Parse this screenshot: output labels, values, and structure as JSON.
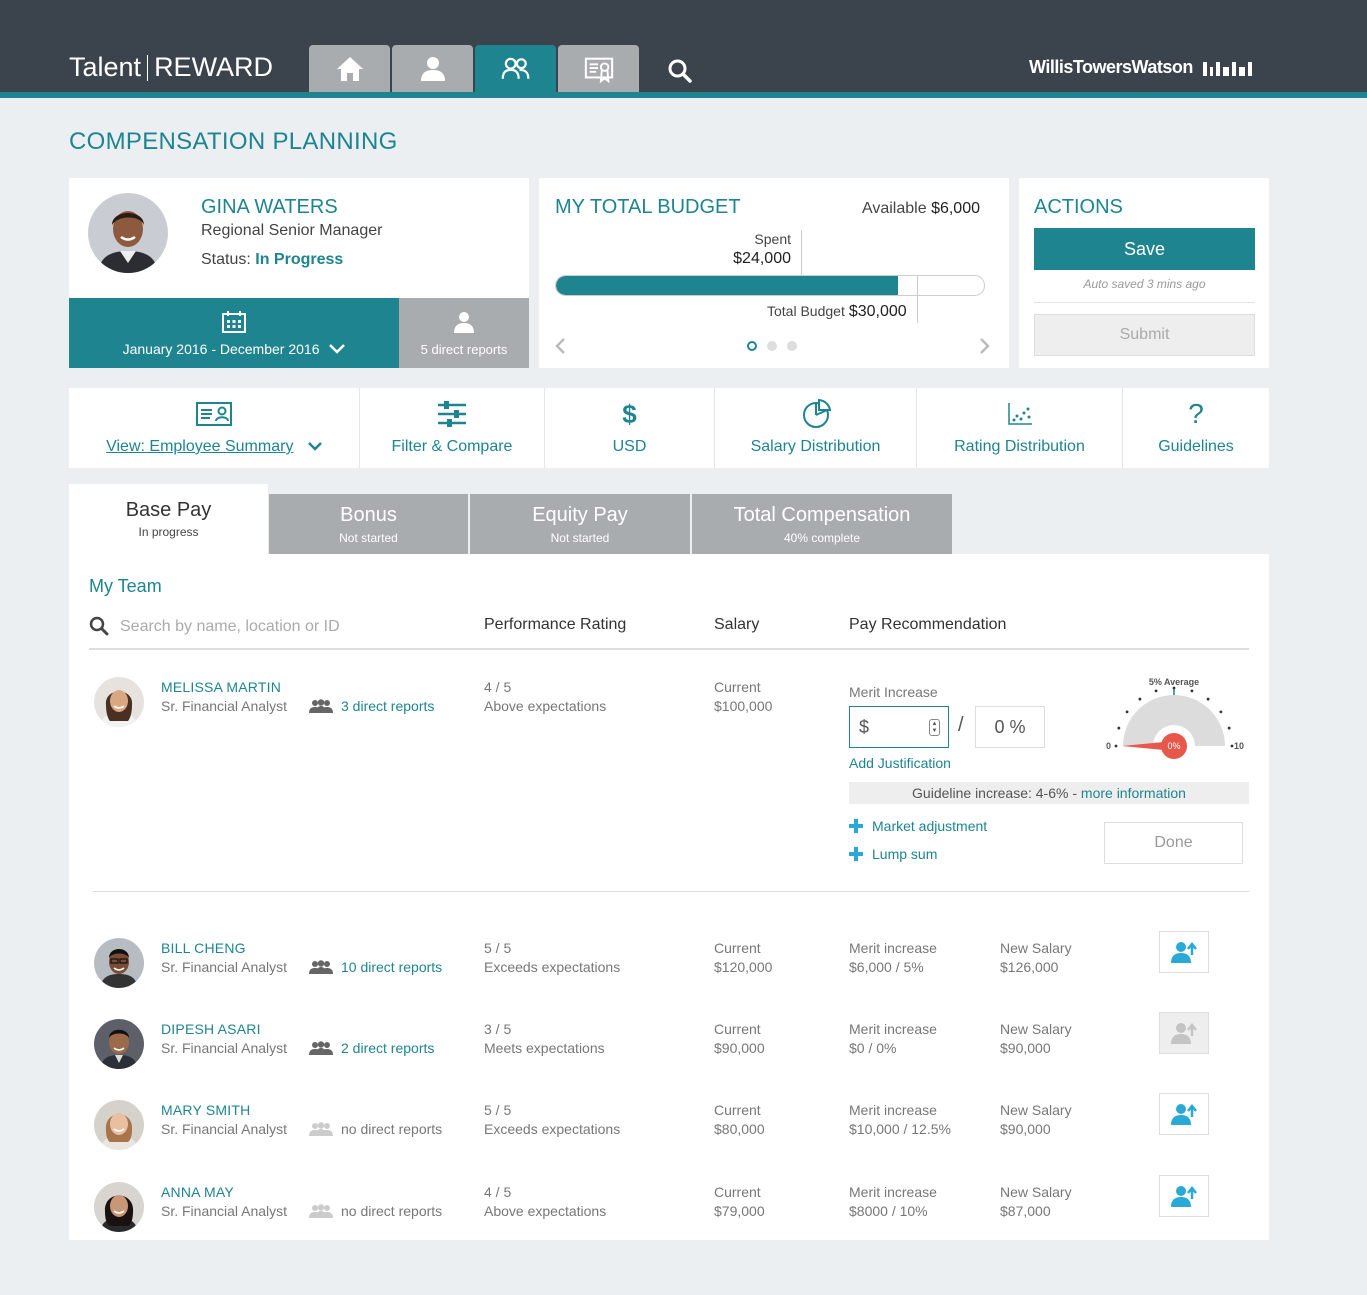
{
  "app": {
    "brand_left": "Talent",
    "brand_right": "REWARD",
    "company": "WillisTowersWatson"
  },
  "nav": {
    "tabs": [
      {
        "name": "home",
        "icon": "home-icon",
        "active": false
      },
      {
        "name": "profile",
        "icon": "person-icon",
        "active": false
      },
      {
        "name": "team",
        "icon": "team-icon",
        "active": true
      },
      {
        "name": "certificate",
        "icon": "certificate-icon",
        "active": false
      }
    ],
    "search_icon": "search-icon"
  },
  "page": {
    "title": "COMPENSATION PLANNING"
  },
  "employee": {
    "name": "GINA WATERS",
    "role": "Regional Senior Manager",
    "status_label": "Status:",
    "status_value": "In Progress",
    "period": "January 2016 - December 2016",
    "reports": "5 direct reports"
  },
  "budget": {
    "title": "MY TOTAL BUDGET",
    "available_label": "Available",
    "available_value": "$6,000",
    "spent_label": "Spent",
    "spent_value": "$24,000",
    "total_label": "Total Budget",
    "total_value": "$30,000",
    "spent_fraction": 0.8,
    "carousel_pages": 3,
    "carousel_active": 0
  },
  "actions": {
    "title": "ACTIONS",
    "save": "Save",
    "autosave": "Auto saved 3 mins ago",
    "submit": "Submit"
  },
  "tools": [
    {
      "icon": "employee-card-icon",
      "label": "View: Employee Summary",
      "dropdown": true
    },
    {
      "icon": "sliders-icon",
      "label": "Filter & Compare"
    },
    {
      "icon": "dollar-icon",
      "label": "USD"
    },
    {
      "icon": "pie-chart-icon",
      "label": "Salary Distribution"
    },
    {
      "icon": "scatter-chart-icon",
      "label": "Rating Distribution"
    },
    {
      "icon": "question-icon",
      "label": "Guidelines"
    }
  ],
  "pay_tabs": [
    {
      "name": "Base Pay",
      "sub": "In progress",
      "active": true
    },
    {
      "name": "Bonus",
      "sub": "Not started"
    },
    {
      "name": "Equity Pay",
      "sub": "Not started"
    },
    {
      "name": "Total Compensation",
      "sub": "40% complete"
    }
  ],
  "team": {
    "title": "My Team",
    "search_placeholder": "Search by name, location or ID",
    "columns": [
      "Performance Rating",
      "Salary",
      "Pay Recommendation"
    ],
    "expanded": {
      "name": "MELISSA MARTIN",
      "title": "Sr. Financial Analyst",
      "reports": "3 direct reports",
      "rating": "4 / 5",
      "rating_text": "Above expectations",
      "salary_label": "Current",
      "salary": "$100,000",
      "merit_label": "Merit Increase",
      "currency_symbol": "$",
      "percent_value": "0 %",
      "add_justification": "Add Justification",
      "guideline_text": "Guideline increase: 4-6%",
      "guideline_sep": " - ",
      "guideline_link": "more information",
      "market_adjustment": "Market adjustment",
      "lump_sum": "Lump sum",
      "done": "Done",
      "gauge": {
        "title": "5% Average",
        "min": "0",
        "max": "10",
        "value_label": "0%",
        "value": 0,
        "average": 5
      }
    },
    "rows": [
      {
        "name": "BILL CHENG",
        "title": "Sr. Financial Analyst",
        "reports": "10 direct reports",
        "has_reports": true,
        "rating": "5 / 5",
        "rating_text": "Exceeds expectations",
        "salary_label": "Current",
        "salary": "$120,000",
        "merit_label": "Merit increase",
        "merit": "$6,000 / 5%",
        "new_label": "New Salary",
        "new_salary": "$126,000",
        "promote_enabled": true
      },
      {
        "name": "DIPESH ASARI",
        "title": "Sr. Financial Analyst",
        "reports": "2 direct reports",
        "has_reports": true,
        "rating": "3 / 5",
        "rating_text": "Meets expectations",
        "salary_label": "Current",
        "salary": "$90,000",
        "merit_label": "Merit increase",
        "merit": "$0 / 0%",
        "new_label": "New Salary",
        "new_salary": "$90,000",
        "promote_enabled": false
      },
      {
        "name": "MARY SMITH",
        "title": "Sr. Financial Analyst",
        "reports": "no direct reports",
        "has_reports": false,
        "rating": "5 / 5",
        "rating_text": "Exceeds expectations",
        "salary_label": "Current",
        "salary": "$80,000",
        "merit_label": "Merit increase",
        "merit": "$10,000 / 12.5%",
        "new_label": "New Salary",
        "new_salary": "$90,000",
        "promote_enabled": true
      },
      {
        "name": "ANNA MAY",
        "title": "Sr. Financial Analyst",
        "reports": "no direct reports",
        "has_reports": false,
        "rating": "4 / 5",
        "rating_text": "Above expectations",
        "salary_label": "Current",
        "salary": "$79,000",
        "merit_label": "Merit increase",
        "merit": "$8000 / 10%",
        "new_label": "New Salary",
        "new_salary": "$87,000",
        "promote_enabled": true
      }
    ]
  },
  "colors": {
    "teal": "#1e8590",
    "header": "#3b434d",
    "tab_gray": "#a9acaf",
    "gauge_red": "#e8584a",
    "link_blue": "#2aa9d6"
  }
}
